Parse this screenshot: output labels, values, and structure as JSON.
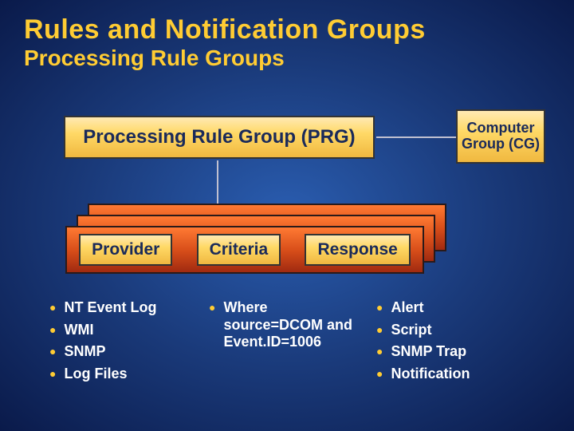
{
  "title": "Rules and Notification Groups",
  "subtitle": "Processing Rule Groups",
  "prg_label": "Processing Rule Group (PRG)",
  "cg_label": "Computer Group (CG)",
  "chips": {
    "provider": "Provider",
    "criteria": "Criteria",
    "response": "Response"
  },
  "providers": [
    "NT Event Log",
    "WMI",
    "SNMP",
    "Log Files"
  ],
  "criteria": [
    "Where source=DCOM and Event.ID=1006"
  ],
  "responses": [
    "Alert",
    "Script",
    "SNMP Trap",
    "Notification"
  ]
}
